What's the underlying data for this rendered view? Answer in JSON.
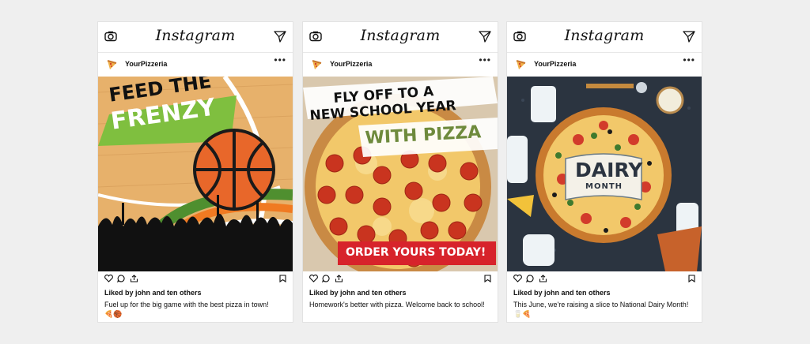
{
  "app": {
    "brand": "Instagram"
  },
  "posts": [
    {
      "username": "YourPizzeria",
      "more": "•••",
      "overlay": {
        "line1": "FEED THE",
        "line2": "FRENZY"
      },
      "likes": "Liked by john and ten others",
      "caption": "Fuel up for the big game with the best pizza in town!",
      "emoji": "🍕🏀"
    },
    {
      "username": "YourPizzeria",
      "more": "•••",
      "overlay": {
        "line1": "FLY OFF TO A",
        "line2": "NEW SCHOOL YEAR",
        "line3": "WITH PIZZA",
        "cta": "ORDER YOURS TODAY!"
      },
      "likes": "Liked by john and ten others",
      "caption": "Homework's better with pizza. Welcome back to school!",
      "emoji": ""
    },
    {
      "username": "YourPizzeria",
      "more": "•••",
      "overlay": {
        "line1": "DAIRY",
        "line2": "MONTH"
      },
      "likes": "Liked by john and ten others",
      "caption": "This June, we're raising a slice to National Dairy Month!",
      "emoji": "🥛🍕"
    }
  ],
  "colors": {
    "accent_green": "#7fbf3f",
    "cta_red": "#d7232b",
    "court_wood": "#e7b16b",
    "board_dark": "#2b3440"
  },
  "icons": [
    "camera-icon",
    "send-icon",
    "pizza-avatar-icon",
    "heart-icon",
    "comment-icon",
    "share-icon",
    "bookmark-icon"
  ]
}
